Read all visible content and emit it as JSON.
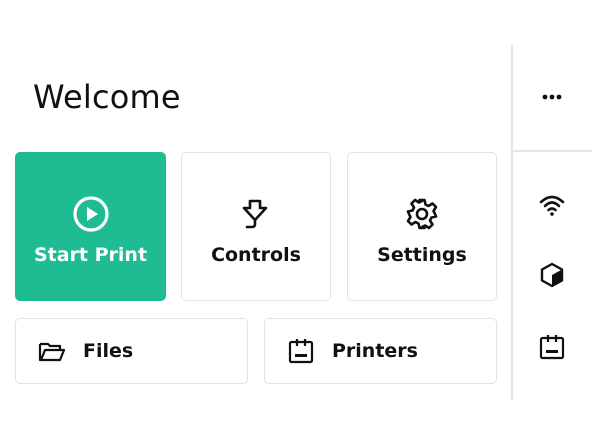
{
  "header": {
    "title": "Welcome"
  },
  "tiles": [
    {
      "label": "Start Print",
      "icon": "play-circle-icon"
    },
    {
      "label": "Controls",
      "icon": "controls-icon"
    },
    {
      "label": "Settings",
      "icon": "gear-icon"
    }
  ],
  "wide_tiles": [
    {
      "label": "Files",
      "icon": "folder-icon"
    },
    {
      "label": "Printers",
      "icon": "printer-icon"
    }
  ],
  "sidebar": {
    "menu_icon": "more-horizontal-icon",
    "status_icons": [
      "wifi-icon",
      "cube-icon",
      "printer-icon"
    ]
  },
  "colors": {
    "accent": "#1fbb92",
    "border": "#e3e3e3"
  }
}
